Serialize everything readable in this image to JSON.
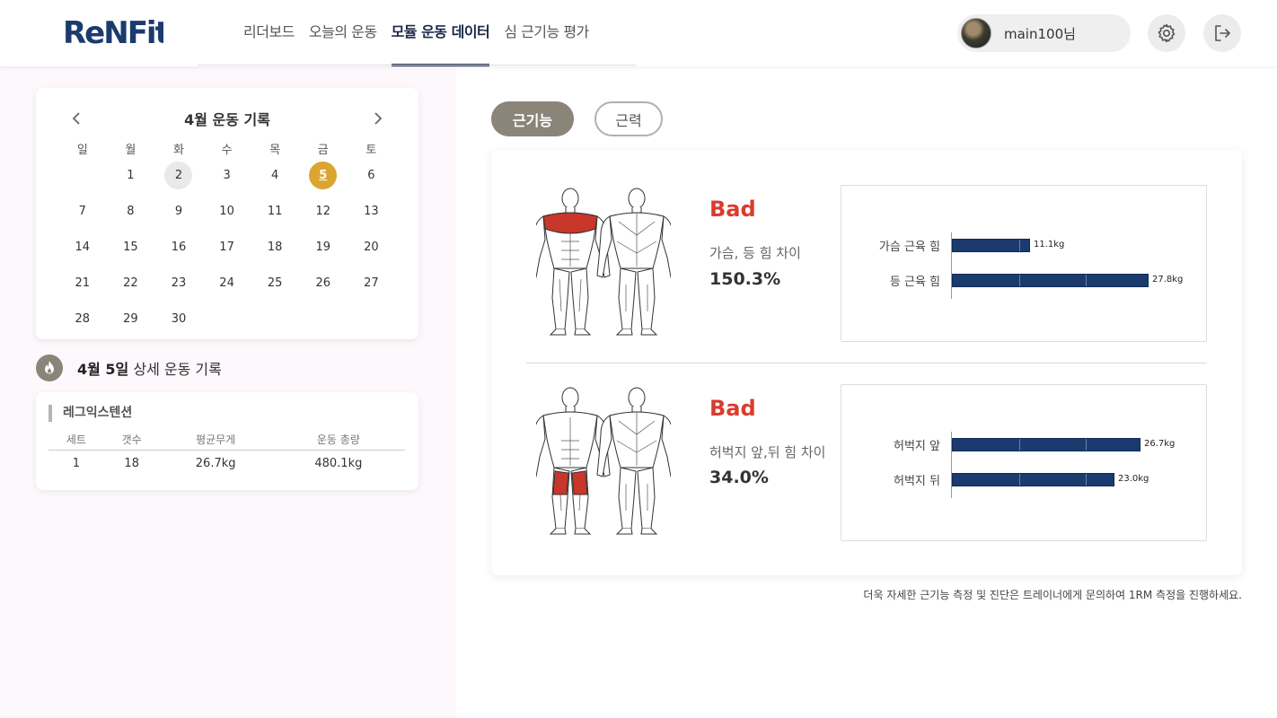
{
  "brand": {
    "logo_text": "ReNFit"
  },
  "nav": {
    "items": [
      {
        "label": "리더보드"
      },
      {
        "label": "오늘의 운동"
      },
      {
        "label": "모듈 운동 데이터"
      },
      {
        "label": "심 근기능 평가"
      }
    ],
    "active_index": 2
  },
  "user": {
    "name": "main100님"
  },
  "header_icons": [
    "gear-icon",
    "logout-icon"
  ],
  "calendar": {
    "title": "4월 운동 기록",
    "weekdays": [
      "일",
      "월",
      "화",
      "수",
      "목",
      "금",
      "토"
    ],
    "weeks": [
      [
        "",
        "1",
        "2",
        "3",
        "4",
        "5",
        "6"
      ],
      [
        "7",
        "8",
        "9",
        "10",
        "11",
        "12",
        "13"
      ],
      [
        "14",
        "15",
        "16",
        "17",
        "18",
        "19",
        "20"
      ],
      [
        "21",
        "22",
        "23",
        "24",
        "25",
        "26",
        "27"
      ],
      [
        "28",
        "29",
        "30",
        "",
        "",
        "",
        ""
      ]
    ],
    "today": "2",
    "selected": "5"
  },
  "detail": {
    "date": "4월 5일",
    "suffix": " 상세 운동 기록"
  },
  "record": {
    "exercise": "레그익스텐션",
    "columns": [
      "세트",
      "갯수",
      "평균무게",
      "운동 총량"
    ],
    "rows": [
      [
        "1",
        "18",
        "26.7kg",
        "480.1kg"
      ]
    ]
  },
  "tabs": {
    "active": "근기능",
    "inactive": "근력"
  },
  "assessments": [
    {
      "status": "Bad",
      "diff_label": "가슴, 등 힘 차이",
      "diff_value": "150.3%",
      "highlight": "chest",
      "bars": [
        {
          "label": "가슴 근육 힘",
          "value": 11.1,
          "value_label": "11.1kg"
        },
        {
          "label": "등 근육 힘",
          "value": 27.8,
          "value_label": "27.8kg"
        }
      ]
    },
    {
      "status": "Bad",
      "diff_label": "허벅지 앞,뒤 힘 차이",
      "diff_value": "34.0%",
      "highlight": "thighs",
      "bars": [
        {
          "label": "허벅지 앞",
          "value": 26.7,
          "value_label": "26.7kg"
        },
        {
          "label": "허벅지 뒤",
          "value": 23.0,
          "value_label": "23.0kg"
        }
      ]
    }
  ],
  "colors": {
    "accent_navy": "#1b2846",
    "bar": "#1b3b6f",
    "bad": "#d93c2e",
    "muscle_highlight": "#c8372a",
    "selected_day": "#dba531",
    "tab_active": "#8b8479"
  },
  "footnote": "더욱 자세한 근기능 측정 및 진단은 트레이너에게 문의하여 1RM 측정을 진행하세요."
}
